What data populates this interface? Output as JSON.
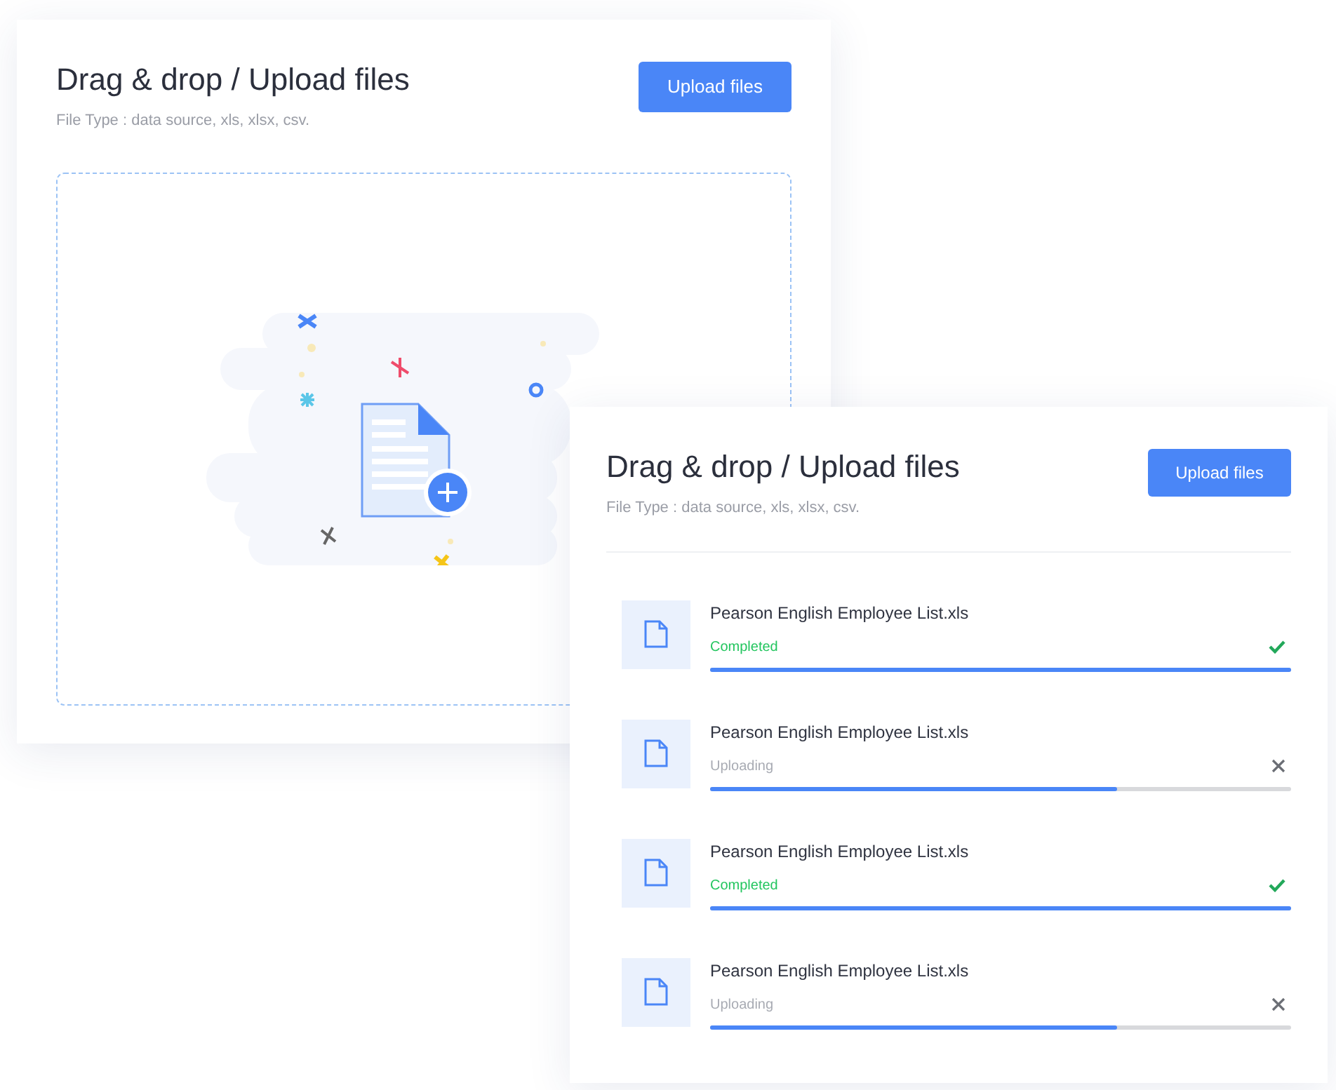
{
  "upload_panel": {
    "title": "Drag & drop / Upload files",
    "subtitle": "File Type : data source, xls, xlsx, csv.",
    "button": "Upload files"
  },
  "files_panel": {
    "title": "Drag & drop / Upload files",
    "subtitle": "File Type : data source, xls, xlsx, csv.",
    "button": "Upload files",
    "files": [
      {
        "name": "Pearson English Employee List.xls",
        "status": "Completed",
        "kind": "completed",
        "level": 1
      },
      {
        "name": "Pearson English Employee List.xls",
        "status": "Uploading",
        "kind": "uploading",
        "level": 0.7
      },
      {
        "name": "Pearson English Employee List.xls",
        "status": "Completed",
        "kind": "completed",
        "level": 1
      },
      {
        "name": "Pearson English Employee List.xls",
        "status": "Uploading",
        "kind": "uploading",
        "level": 0.7
      }
    ]
  }
}
